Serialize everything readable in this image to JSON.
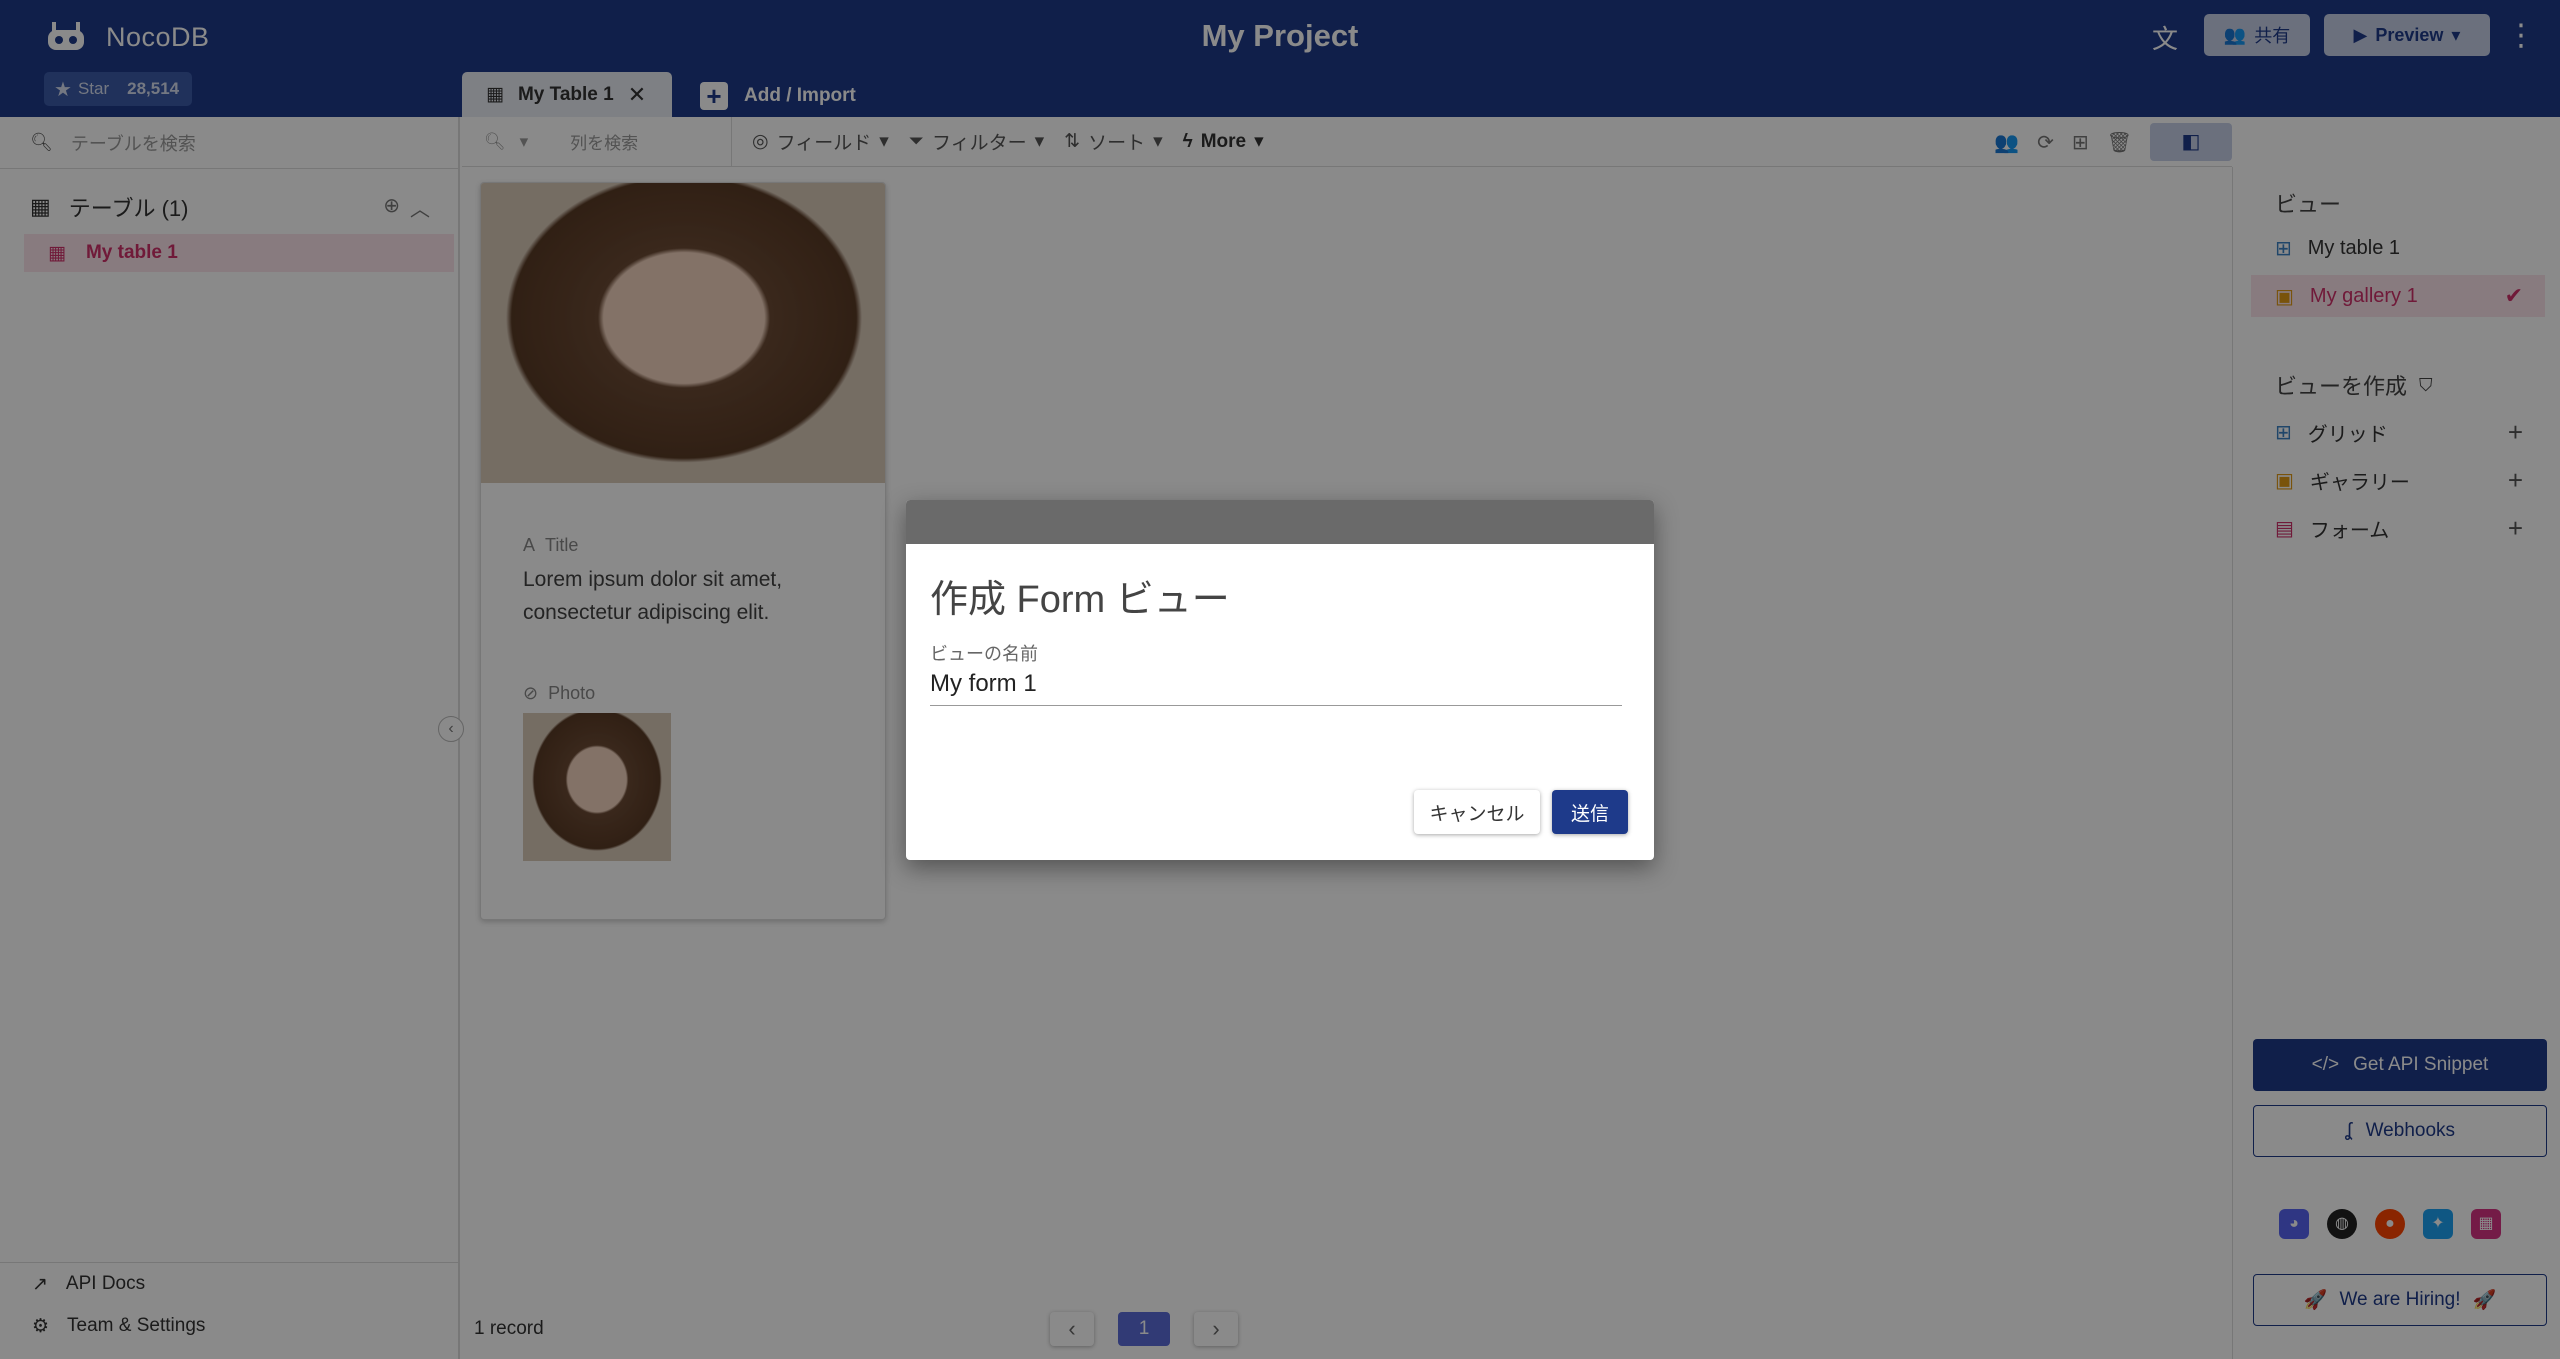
{
  "header": {
    "app_name": "NocoDB",
    "star_label": "Star",
    "star_count": "28,514",
    "project_title": "My Project",
    "share_label": "共有",
    "preview_label": "Preview",
    "brand_color": "#1e3a8a"
  },
  "tabs": {
    "active_tab": "My Table 1",
    "add_import": "Add / Import"
  },
  "left_sidebar": {
    "search_placeholder": "テーブルを検索",
    "tables_header": "テーブル (1)",
    "tables": [
      {
        "label": "My table 1"
      }
    ],
    "api_docs": "API Docs",
    "team_settings": "Team & Settings"
  },
  "toolbar": {
    "search_placeholder": "列を検索",
    "fields": "フィールド",
    "filter": "フィルター",
    "sort": "ソート",
    "more": "More"
  },
  "gallery": {
    "card": {
      "title_label": "Title",
      "title_value": "Lorem ipsum dolor sit amet, consectetur adipiscing elit.",
      "photo_label": "Photo"
    },
    "record_count": "1 record",
    "current_page": "1"
  },
  "right_panel": {
    "views_title": "ビュー",
    "views": [
      {
        "label": "My table 1",
        "icon": "grid-icon"
      },
      {
        "label": "My gallery 1",
        "icon": "gallery-icon",
        "active": true
      }
    ],
    "create_title": "ビューを作成",
    "create_options": [
      {
        "label": "グリッド",
        "icon": "grid-icon"
      },
      {
        "label": "ギャラリー",
        "icon": "gallery-icon"
      },
      {
        "label": "フォーム",
        "icon": "form-icon"
      }
    ],
    "api_snippet": "Get API Snippet",
    "webhooks": "Webhooks",
    "hiring": "We are Hiring!"
  },
  "dialog": {
    "title": "作成 Form ビュー",
    "name_label": "ビューの名前",
    "name_value": "My form 1",
    "cancel": "キャンセル",
    "submit": "送信"
  }
}
